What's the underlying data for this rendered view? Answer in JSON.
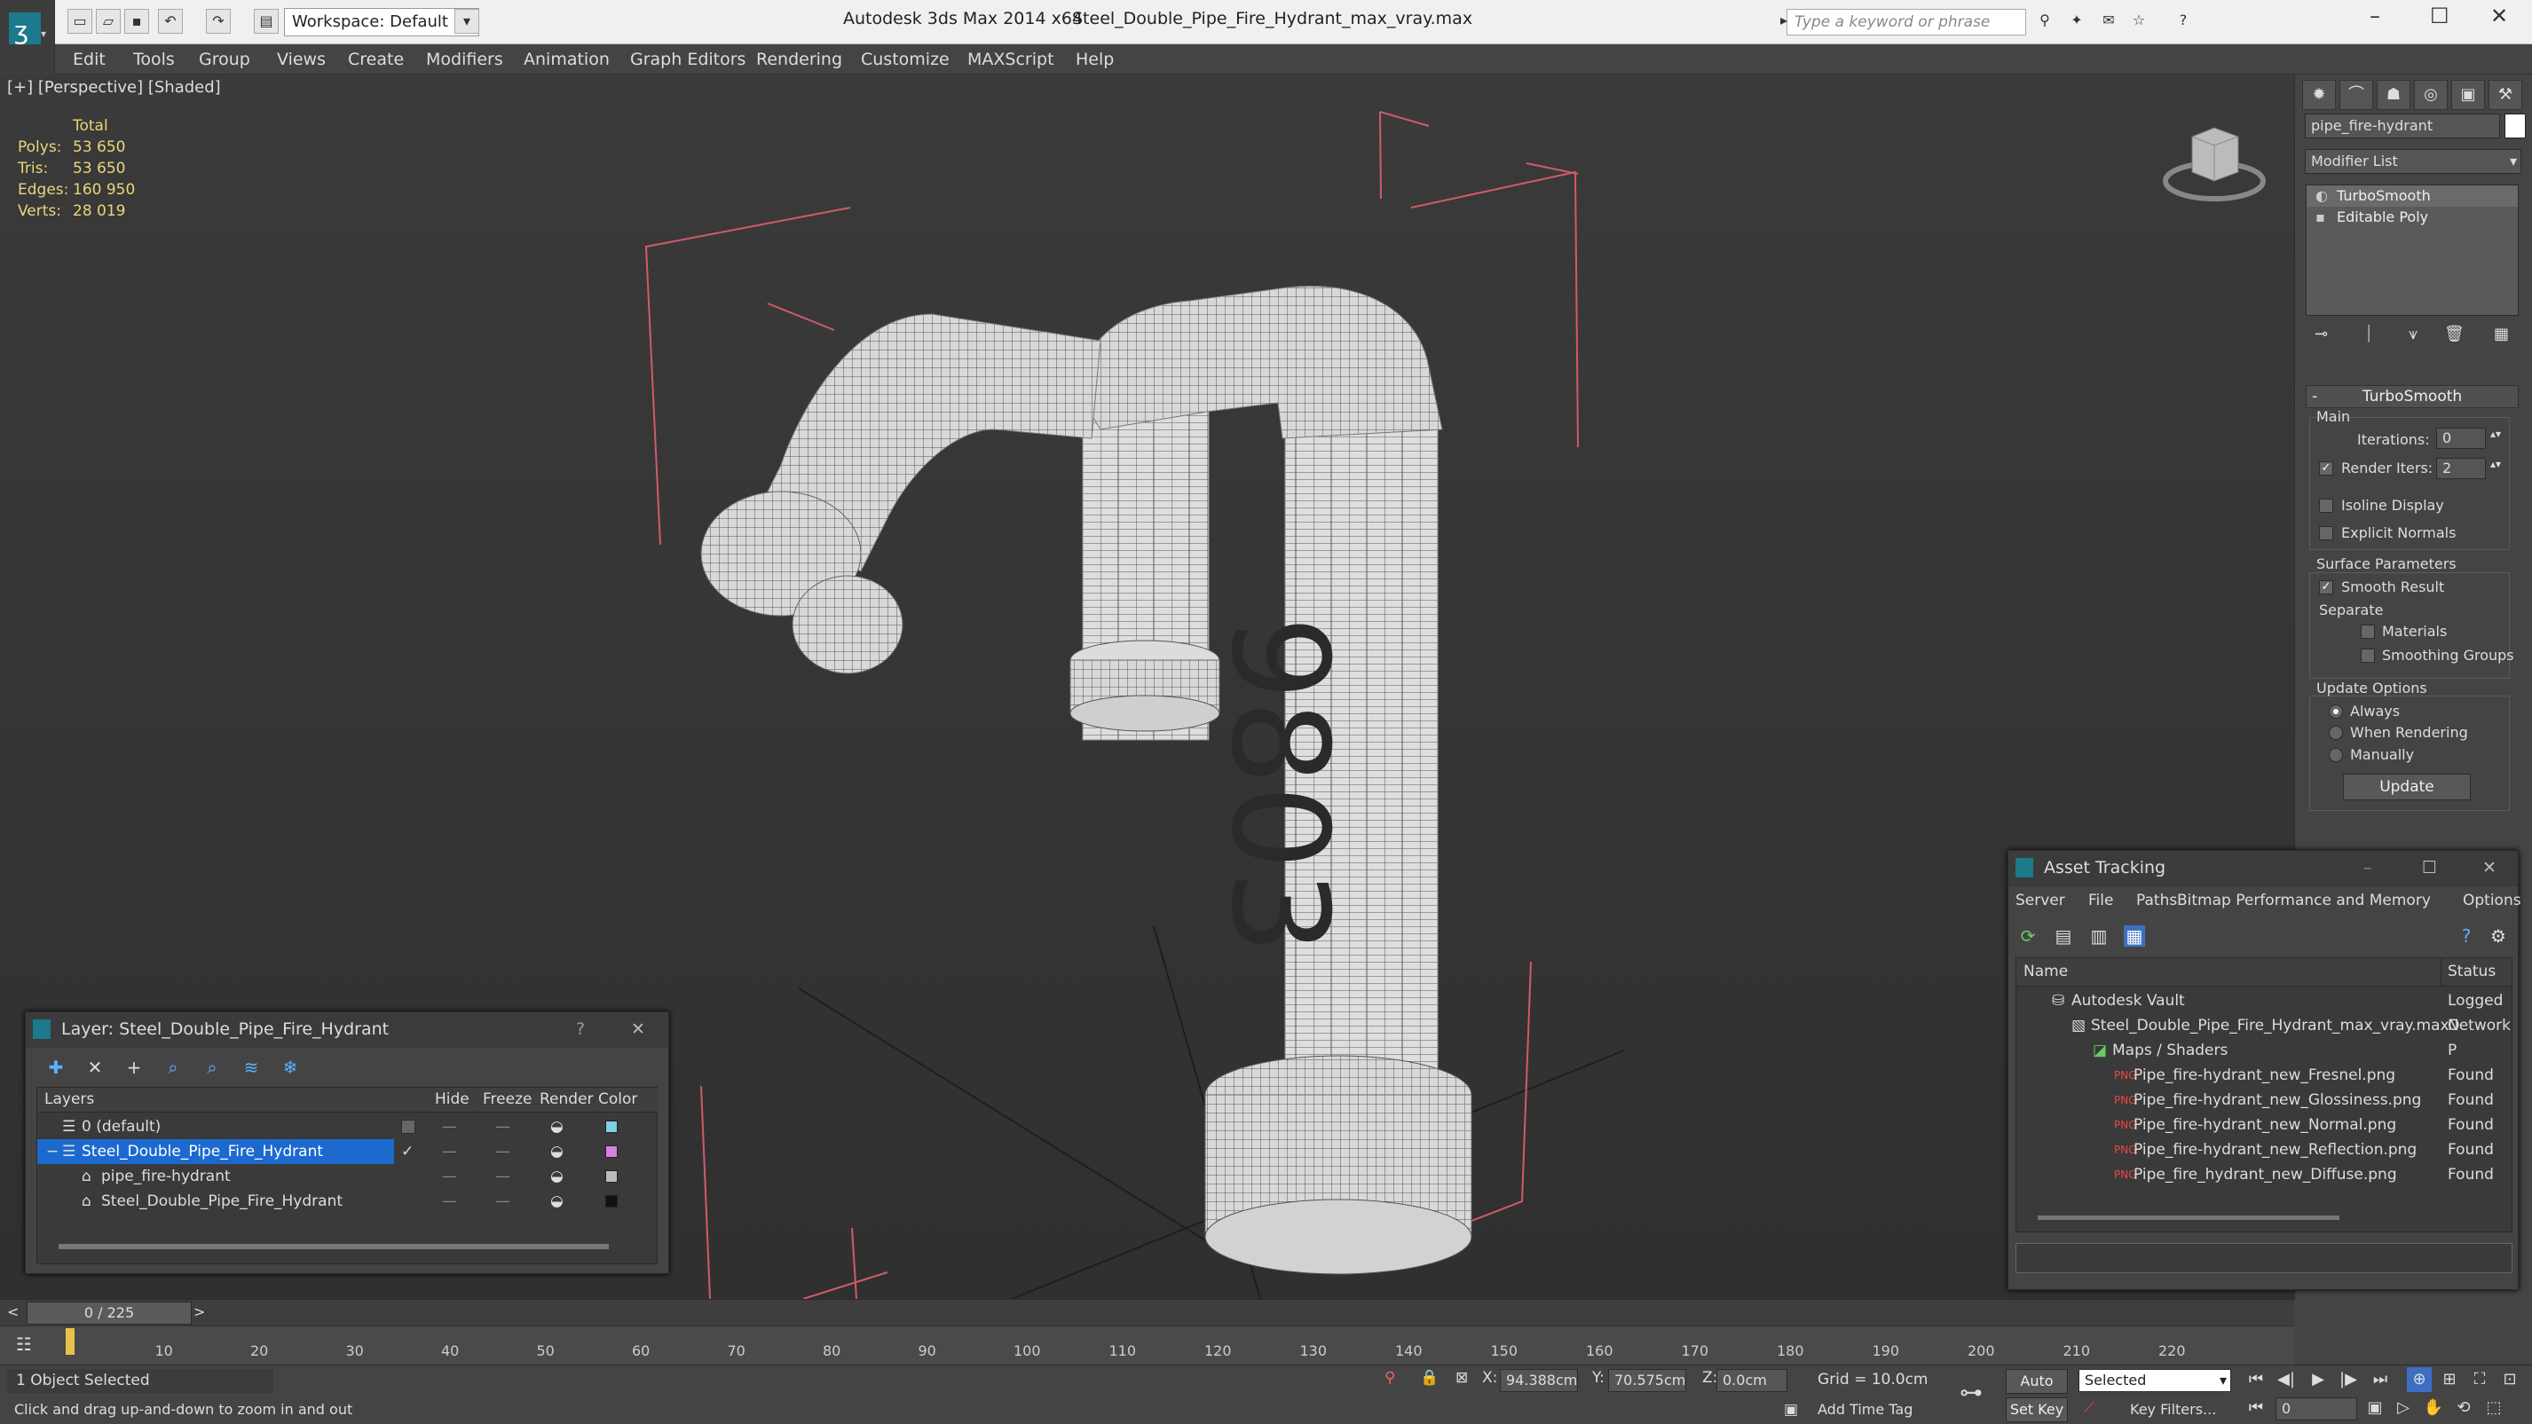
{
  "app": {
    "title": "Autodesk 3ds Max  2014 x64",
    "file": "Steel_Double_Pipe_Fire_Hydrant_max_vray.max",
    "workspace": "Workspace: Default",
    "search_placeholder": "Type a keyword or phrase"
  },
  "menu": [
    "Edit",
    "Tools",
    "Group",
    "Views",
    "Create",
    "Modifiers",
    "Animation",
    "Graph Editors",
    "Rendering",
    "Customize",
    "MAXScript",
    "Help"
  ],
  "viewport": {
    "label": "[+] [Perspective] [Shaded]",
    "stats_header": "Total",
    "stats": [
      {
        "label": "Polys:",
        "value": "53 650"
      },
      {
        "label": "Tris:",
        "value": "53 650"
      },
      {
        "label": "Edges:",
        "value": "160 950"
      },
      {
        "label": "Verts:",
        "value": "28 019"
      }
    ],
    "model_numbers": "9803"
  },
  "command_panel": {
    "object_name": "pipe_fire-hydrant",
    "modifier_list": "Modifier List",
    "stack": [
      "TurboSmooth",
      "Editable Poly"
    ],
    "rollout_title": "TurboSmooth",
    "main_label": "Main",
    "iterations_label": "Iterations:",
    "iterations_value": "0",
    "render_iters_label": "Render Iters:",
    "render_iters_value": "2",
    "isoline": "Isoline Display",
    "explicit": "Explicit Normals",
    "surface_params": "Surface Parameters",
    "smooth_result": "Smooth Result",
    "separate": "Separate",
    "materials": "Materials",
    "smoothing_groups": "Smoothing Groups",
    "update_options": "Update Options",
    "always": "Always",
    "when_rendering": "When Rendering",
    "manually": "Manually",
    "update_button": "Update"
  },
  "layer_window": {
    "title": "Layer: Steel_Double_Pipe_Fire_Hydrant",
    "help": "?",
    "columns": [
      "Layers",
      "Hide",
      "Freeze",
      "Render",
      "Color"
    ],
    "rows": [
      {
        "name": "0 (default)",
        "color": "#7fd0e0"
      },
      {
        "name": "Steel_Double_Pipe_Fire_Hydrant",
        "color": "#d880e0"
      },
      {
        "name": "pipe_fire-hydrant",
        "color": "#bbbbbb"
      },
      {
        "name": "Steel_Double_Pipe_Fire_Hydrant",
        "color": "#111111"
      }
    ]
  },
  "asset_window": {
    "title": "Asset Tracking",
    "menu": [
      "Server",
      "File",
      "Paths",
      "Bitmap Performance and Memory",
      "Options"
    ],
    "columns": [
      "Name",
      "Status"
    ],
    "rows": [
      {
        "name": "Autodesk Vault",
        "status": "Logged O"
      },
      {
        "name": "Steel_Double_Pipe_Fire_Hydrant_max_vray.max",
        "status": "Network P"
      },
      {
        "name": "Maps / Shaders",
        "status": ""
      },
      {
        "name": "Pipe_fire-hydrant_new_Fresnel.png",
        "status": "Found"
      },
      {
        "name": "Pipe_fire-hydrant_new_Glossiness.png",
        "status": "Found"
      },
      {
        "name": "Pipe_fire-hydrant_new_Normal.png",
        "status": "Found"
      },
      {
        "name": "Pipe_fire-hydrant_new_Reflection.png",
        "status": "Found"
      },
      {
        "name": "Pipe_fire_hydrant_new_Diffuse.png",
        "status": "Found"
      }
    ]
  },
  "timeline": {
    "frame": "0 / 225",
    "ticks": [
      "10",
      "20",
      "30",
      "40",
      "50",
      "60",
      "70",
      "80",
      "90",
      "100",
      "110",
      "120",
      "130",
      "140",
      "150",
      "160",
      "170",
      "180",
      "190",
      "200",
      "210",
      "220"
    ]
  },
  "status": {
    "selected": "1 Object Selected",
    "prompt": "Click and drag up-and-down to zoom in and out",
    "x_label": "X:",
    "x": "94.388cm",
    "y_label": "Y:",
    "y": "70.575cm",
    "z_label": "Z:",
    "z": "0.0cm",
    "grid": "Grid = 10.0cm",
    "add_time_tag": "Add Time Tag",
    "auto_key": "Auto Key",
    "set_key": "Set Key",
    "selected_dropdown": "Selected",
    "key_filters": "Key Filters...",
    "frame_field": "0"
  }
}
